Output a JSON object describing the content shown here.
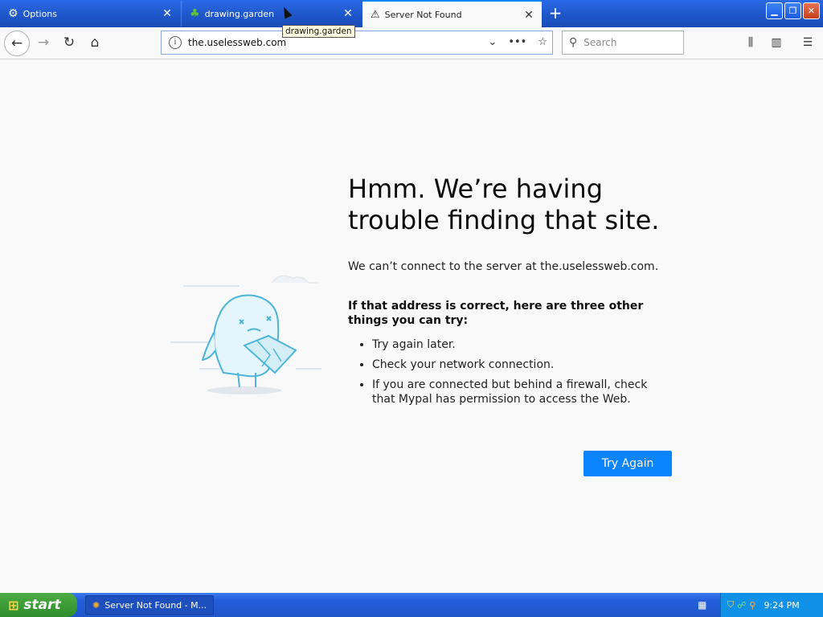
{
  "tabs": [
    {
      "label": "Options",
      "icon": "gear-icon"
    },
    {
      "label": "drawing.garden",
      "icon": "cactus-icon"
    },
    {
      "label": "Server Not Found",
      "icon": "warning-icon"
    }
  ],
  "tooltip": "drawing.garden",
  "navbar": {
    "url": "the.uselessweb.com",
    "search_placeholder": "Search"
  },
  "error": {
    "title": "Hmm. We’re having trouble finding that site.",
    "description": "We can’t connect to the server at the.uselessweb.com.",
    "subheading": "If that address is correct, here are three other things you can try:",
    "suggestions": [
      "Try again later.",
      "Check your network connection.",
      "If you are connected but behind a firewall, check that Mypal has permission to access the Web."
    ],
    "button_label": "Try Again"
  },
  "taskbar": {
    "start_label": "start",
    "task_label": "Server Not Found - M...",
    "clock": "9:24 PM"
  },
  "colors": {
    "accent": "#0a84ff",
    "titlebar": "#245edb",
    "start": "#3c9a37"
  }
}
